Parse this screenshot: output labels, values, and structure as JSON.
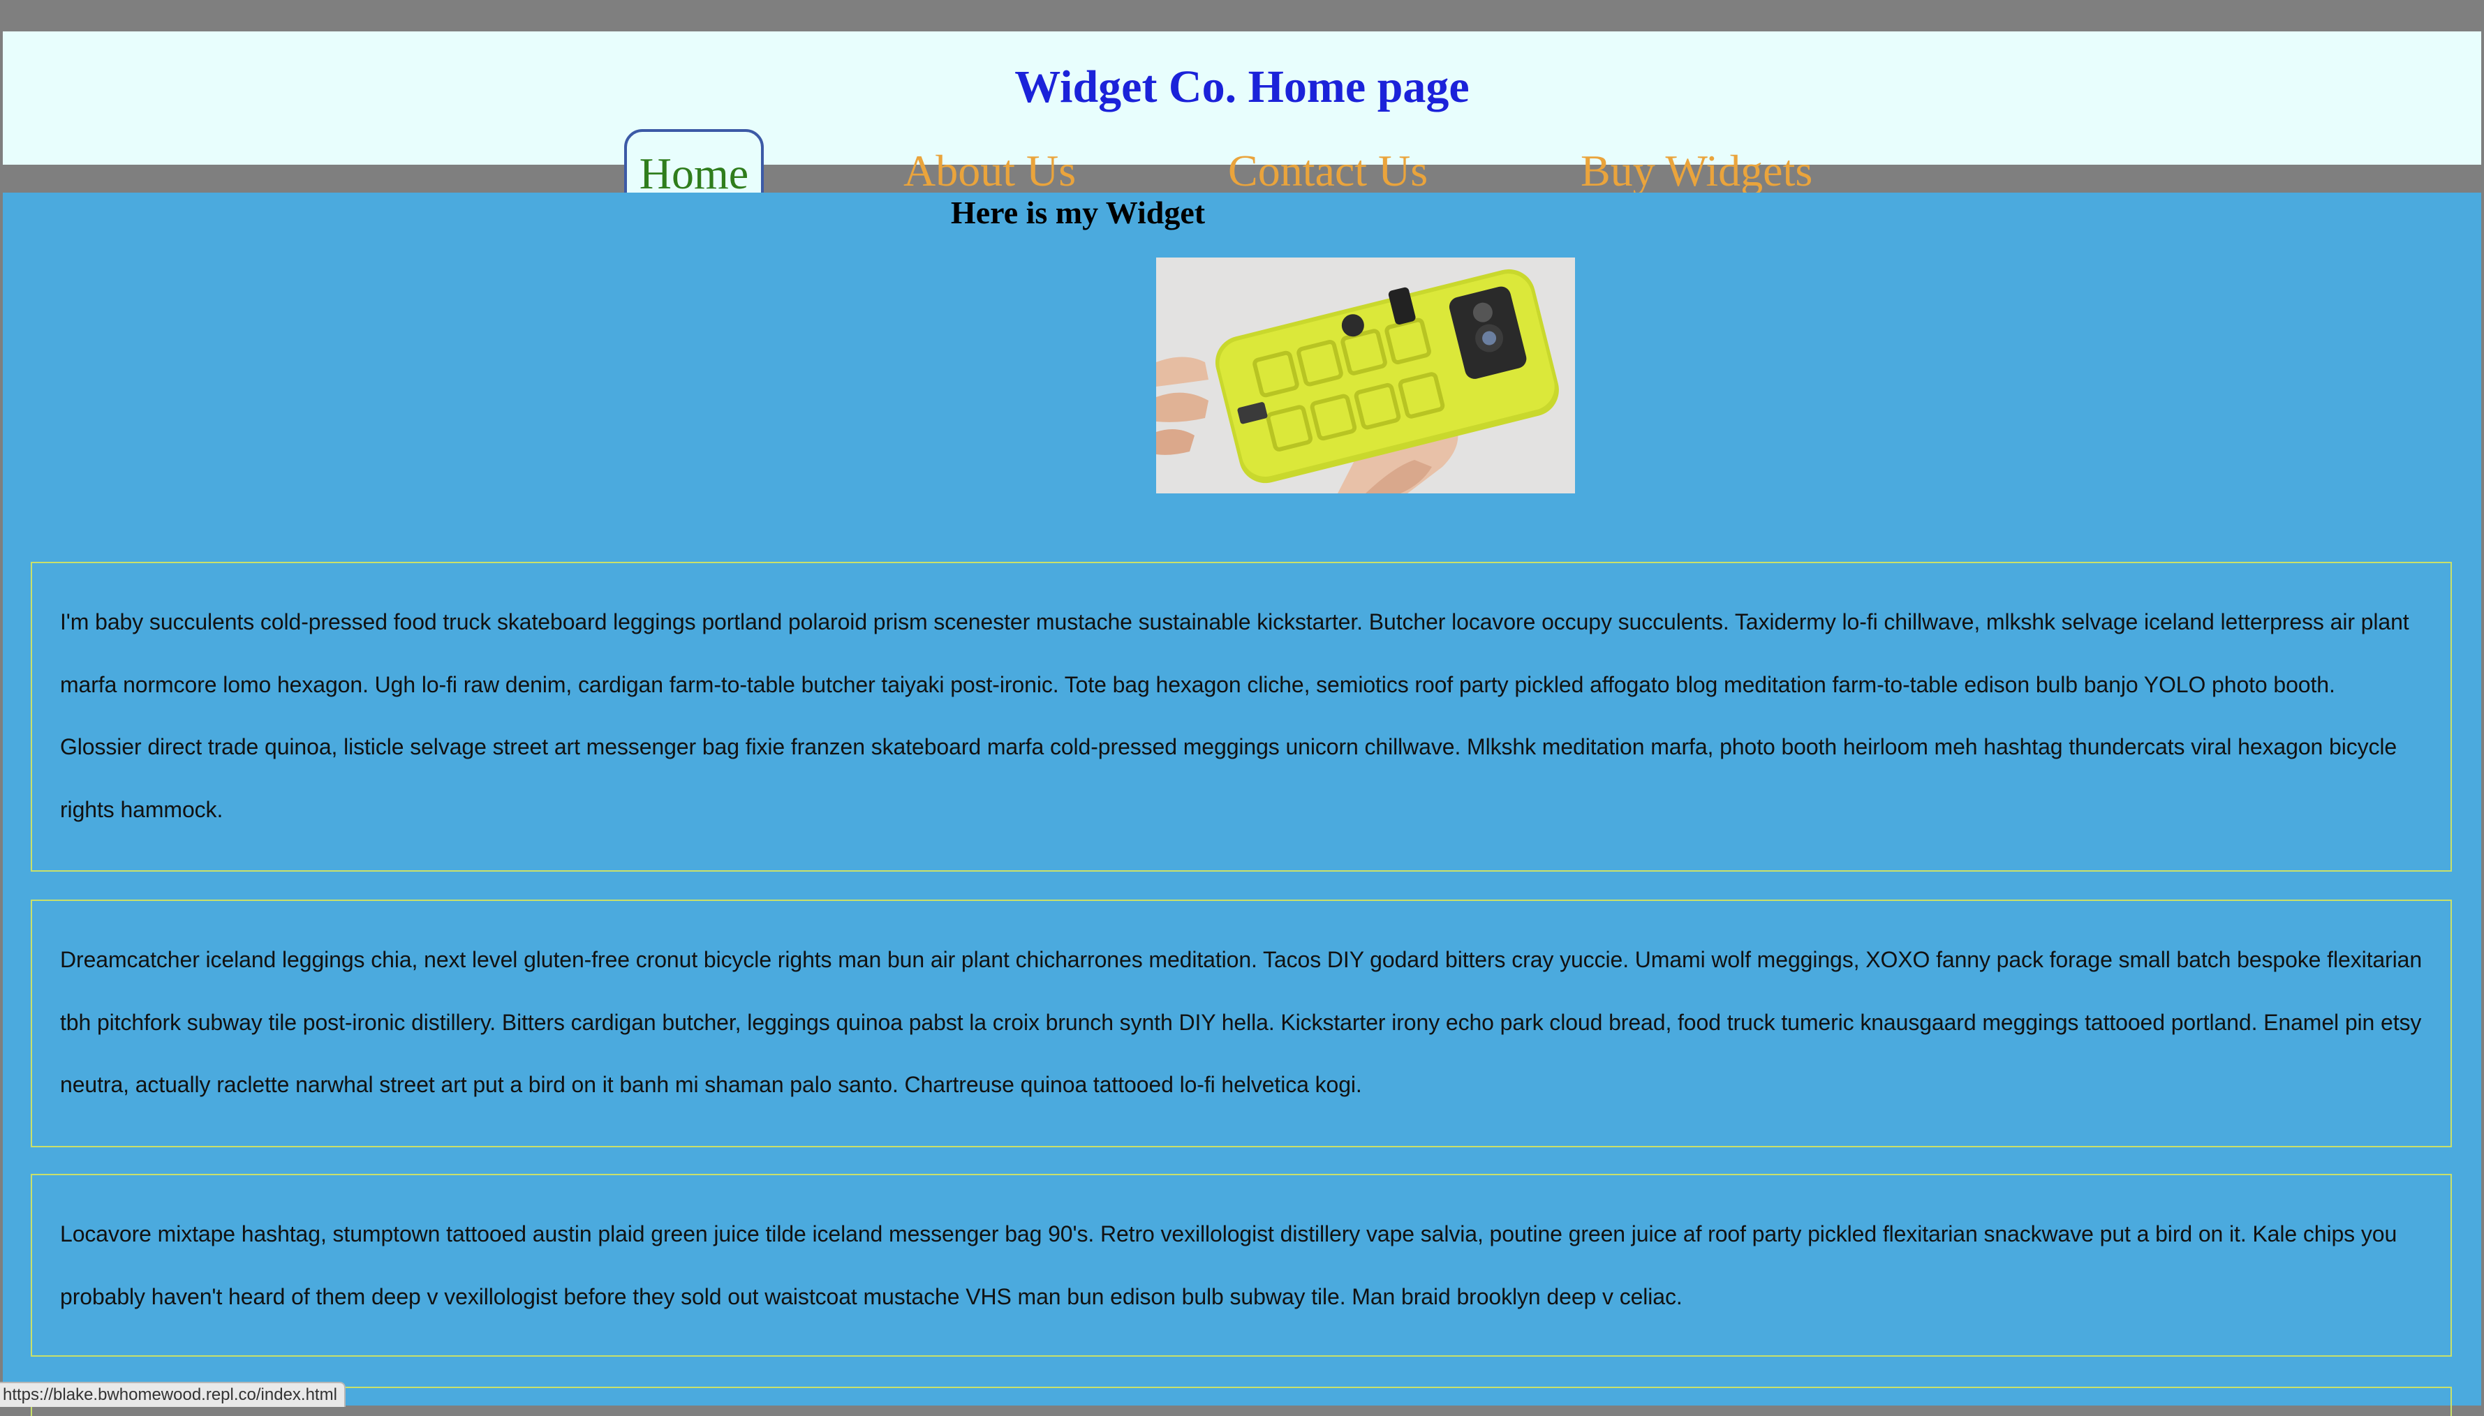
{
  "header": {
    "title": "Widget Co. Home page",
    "nav": [
      {
        "label": "Home",
        "active": true
      },
      {
        "label": "About Us"
      },
      {
        "label": "Contact Us"
      },
      {
        "label": "Buy Widgets"
      }
    ]
  },
  "main": {
    "heading": "Here is my Widget",
    "image": {
      "alt": "Yellow widget phone case held in hand"
    },
    "paragraphs": [
      "I'm baby succulents cold-pressed food truck skateboard leggings portland polaroid prism scenester mustache sustainable kickstarter. Butcher locavore occupy succulents. Taxidermy lo-fi chillwave, mlkshk selvage iceland letterpress air plant marfa normcore lomo hexagon. Ugh lo-fi raw denim, cardigan farm-to-table butcher taiyaki post-ironic. Tote bag hexagon cliche, semiotics roof party pickled affogato blog meditation farm-to-table edison bulb banjo YOLO photo booth. Glossier direct trade quinoa, listicle selvage street art messenger bag fixie franzen skateboard marfa cold-pressed meggings unicorn chillwave. Mlkshk meditation marfa, photo booth heirloom meh hashtag thundercats viral hexagon bicycle rights hammock.",
      "Dreamcatcher iceland leggings chia, next level gluten-free cronut bicycle rights man bun air plant chicharrones meditation. Tacos DIY godard bitters cray yuccie. Umami wolf meggings, XOXO fanny pack forage small batch bespoke flexitarian tbh pitchfork subway tile post-ironic distillery. Bitters cardigan butcher, leggings quinoa pabst la croix brunch synth DIY hella. Kickstarter irony echo park cloud bread, food truck tumeric knausgaard meggings tattooed portland. Enamel pin etsy neutra, actually raclette narwhal street art put a bird on it banh mi shaman palo santo. Chartreuse quinoa tattooed lo-fi helvetica kogi.",
      "Locavore mixtape hashtag, stumptown tattooed austin plaid green juice tilde iceland messenger bag 90's. Retro vexillologist distillery vape salvia, poutine green juice af roof party pickled flexitarian snackwave put a bird on it. Kale chips you probably haven't heard of them deep v vexillologist before they sold out waistcoat mustache VHS man bun edison bulb subway tile. Man braid brooklyn deep v celiac."
    ]
  },
  "status_bar": {
    "url": "https://blake.bwhomewood.repl.co/index.html"
  },
  "colors": {
    "page_bg": "#7f7f7f",
    "header_bg": "#e8fefd",
    "title": "#1b22d9",
    "nav_active": "#2f7d1c",
    "nav_link": "#eaa43c",
    "main_bg": "#4baade",
    "box_border": "#c9e06a"
  }
}
